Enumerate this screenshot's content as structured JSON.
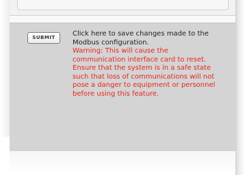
{
  "form": {
    "submit_label": "SUBMIT",
    "description": "Click here to save changes made to the Modbus configuration.",
    "warning": "Warning: This will cause the communication interface card to reset. Ensure that the system is in a safe state such that loss of communications will not pose a danger to equipment or personnel before using this feature."
  },
  "colors": {
    "panel_background": "#d4d4d4",
    "warning_text": "#e8261c",
    "description_text": "#222222"
  }
}
